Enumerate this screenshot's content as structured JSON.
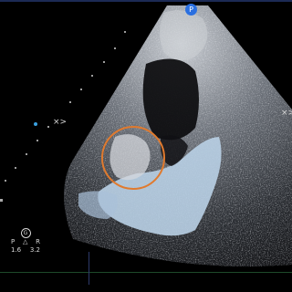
{
  "image": {
    "kind": "echocardiogram",
    "colors": {
      "background": "#000000",
      "tissue": "#9a9ea6",
      "blood_pool": "#b9d0e6",
      "highlight_circle": "#e07a2e",
      "probe_marker": "#2a6fe0",
      "scale_text": "#d8d8d8"
    },
    "scale": {
      "orientation_glyph": "G",
      "left_letter": "P",
      "right_letter": "R",
      "left_value": "1.6",
      "right_value": "3.2"
    },
    "probe_marker_label": "P",
    "annotation": "circle-highlight"
  }
}
